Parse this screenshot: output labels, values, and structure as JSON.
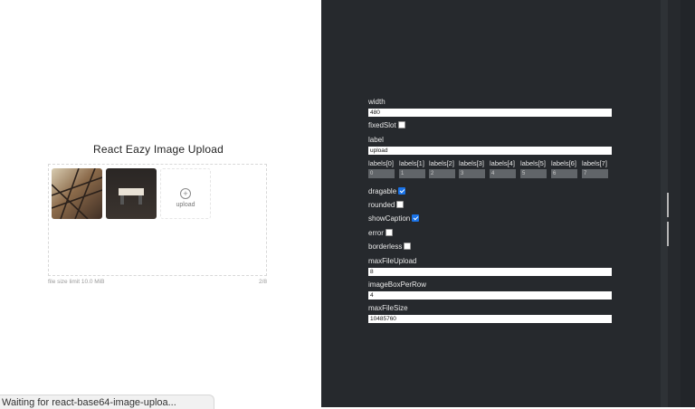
{
  "uploader": {
    "title": "React Eazy Image Upload",
    "upload_label": "upload",
    "file_size_limit": "file size limit 10.0 MiB",
    "count": "2/8"
  },
  "status_bar": {
    "text": "Waiting for react-base64-image-uploa..."
  },
  "knobs": {
    "width": {
      "label": "width",
      "value": "480"
    },
    "fixedSlot": {
      "label": "fixedSlot",
      "checked": false
    },
    "label": {
      "label": "label",
      "value": "upload"
    },
    "labels": [
      {
        "label": "labels[0]",
        "value": "0"
      },
      {
        "label": "labels[1]",
        "value": "1"
      },
      {
        "label": "labels[2]",
        "value": "2"
      },
      {
        "label": "labels[3]",
        "value": "3"
      },
      {
        "label": "labels[4]",
        "value": "4"
      },
      {
        "label": "labels[5]",
        "value": "5"
      },
      {
        "label": "labels[6]",
        "value": "6"
      },
      {
        "label": "labels[7]",
        "value": "7"
      }
    ],
    "dragable": {
      "label": "dragable",
      "checked": true
    },
    "rounded": {
      "label": "rounded",
      "checked": false
    },
    "showCaption": {
      "label": "showCaption",
      "checked": true
    },
    "error": {
      "label": "error",
      "checked": false
    },
    "borderless": {
      "label": "borderless",
      "checked": false
    },
    "maxFileUpload": {
      "label": "maxFileUpload",
      "value": "8"
    },
    "imageBoxPerRow": {
      "label": "imageBoxPerRow",
      "value": "4"
    },
    "maxFileSize": {
      "label": "maxFileSize",
      "value": "10485760"
    }
  },
  "colors": {
    "panel_bg": "#26292d",
    "checkbox_on": "#1a73e8"
  }
}
